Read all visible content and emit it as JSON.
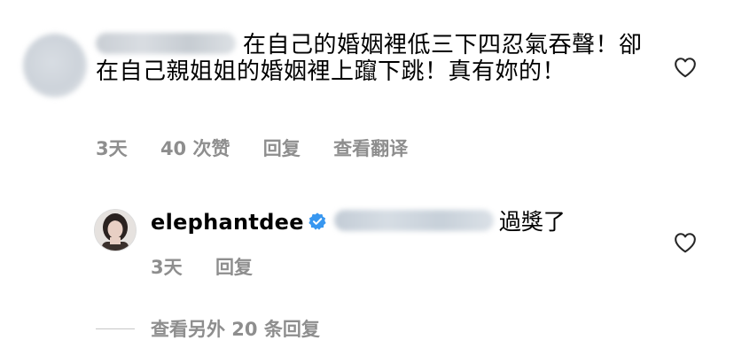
{
  "comment": {
    "text": "在自己的婚姻裡低三下四忍氣吞聲！卻在自己親姐姐的婚姻裡上躥下跳！真有妳的！",
    "time": "3天",
    "likes": "40 次赞",
    "reply_label": "回复",
    "translate_label": "查看翻译",
    "like_icon": "heart-outline-icon"
  },
  "reply": {
    "username": "elephantdee",
    "verified_icon": "verified-badge-icon",
    "text": "過獎了",
    "time": "3天",
    "reply_label": "回复",
    "like_icon": "heart-outline-icon"
  },
  "view_more": {
    "label": "查看另外 20 条回复"
  },
  "colors": {
    "text": "#000000",
    "secondary": "#8e8e8e",
    "verified": "#3897f0"
  }
}
